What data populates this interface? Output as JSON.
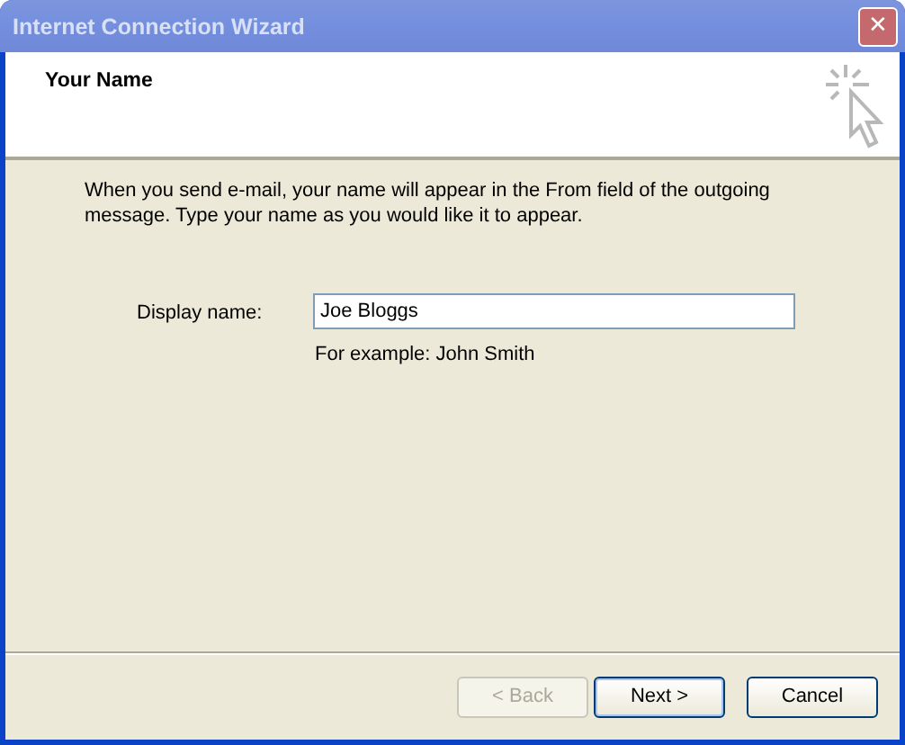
{
  "window": {
    "title": "Internet Connection Wizard",
    "close": "✕"
  },
  "header": {
    "title": "Your Name"
  },
  "intro": "When you send e-mail, your name will appear in the From field of the outgoing message. Type your name as you would like it to appear.",
  "field": {
    "label": "Display name:",
    "value": "Joe Bloggs",
    "hint": "For example: John Smith"
  },
  "buttons": [
    {
      "label": "< Back",
      "disabled": true,
      "default": false
    },
    {
      "label": "Next >",
      "disabled": false,
      "default": true
    },
    {
      "label": "Cancel",
      "disabled": false,
      "default": false
    }
  ]
}
